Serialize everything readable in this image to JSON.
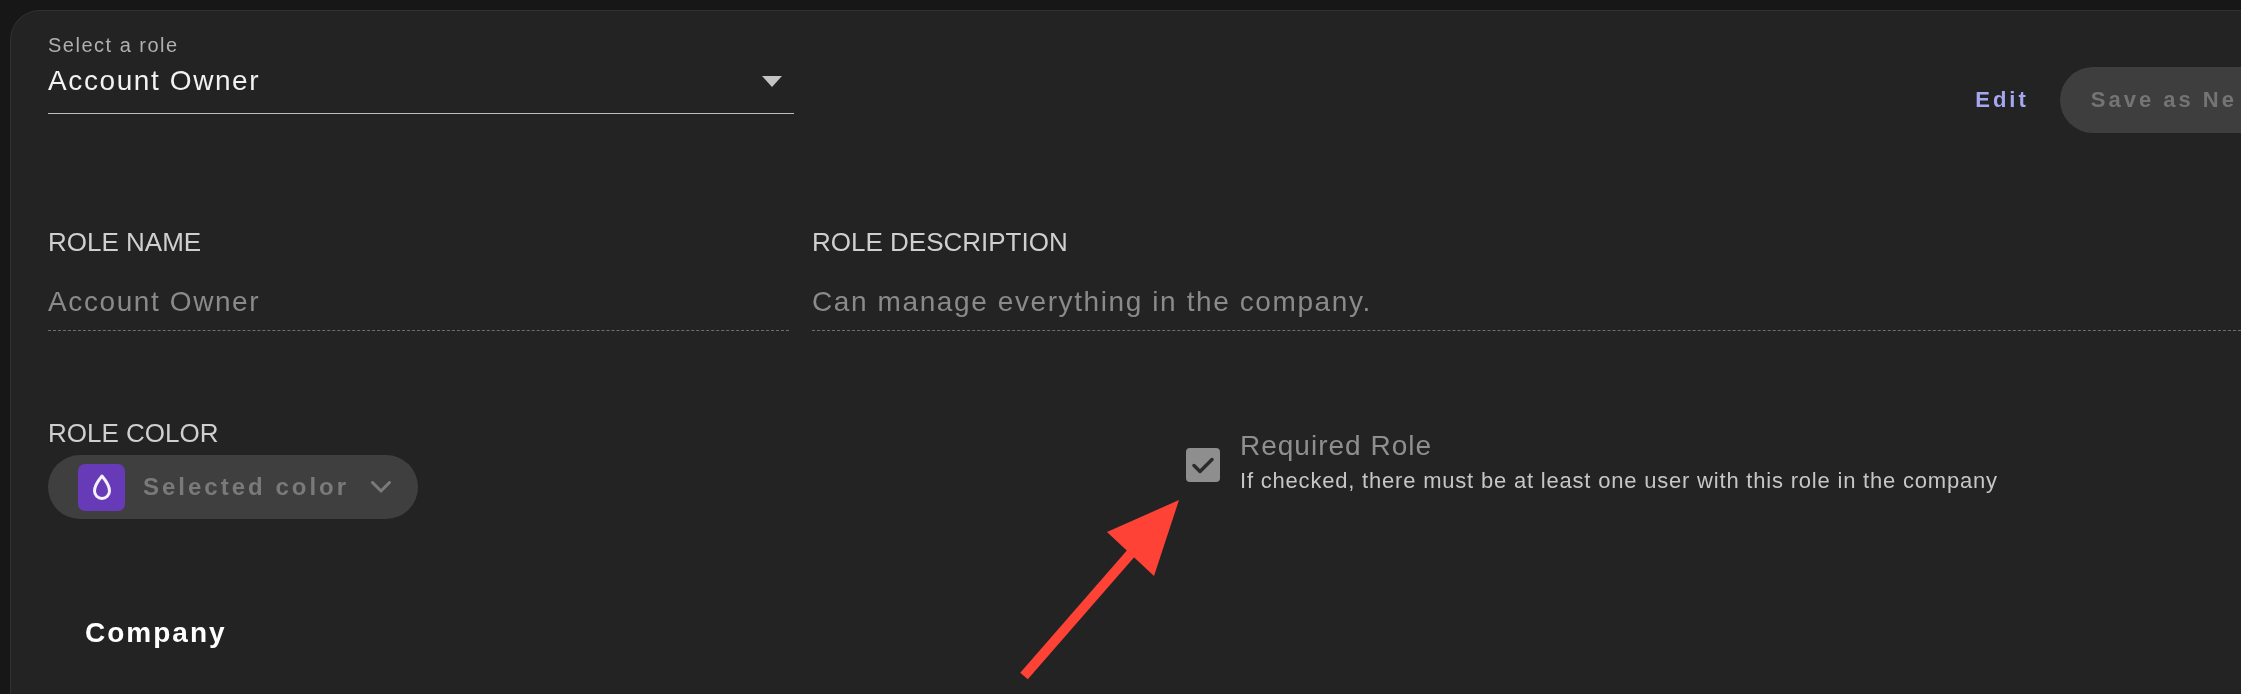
{
  "role_select": {
    "label": "Select a role",
    "value": "Account Owner"
  },
  "actions": [
    {
      "kind": "link",
      "label": "Edit",
      "disabled": false
    },
    {
      "kind": "button",
      "label": "Save as Ne",
      "disabled": true
    }
  ],
  "fields": [
    {
      "label": "ROLE NAME",
      "value": "Account Owner",
      "disabled": true
    },
    {
      "label": "ROLE DESCRIPTION",
      "value": "Can manage everything in the company.",
      "disabled": true
    }
  ],
  "role_color": {
    "label": "ROLE COLOR",
    "button_label": "Selected color",
    "color": "#673ab7"
  },
  "required_role": {
    "label": "Required Role",
    "description": "If checked, there must be at least one user with this role in the company",
    "checked": true,
    "disabled": true
  },
  "section_title": "Company"
}
